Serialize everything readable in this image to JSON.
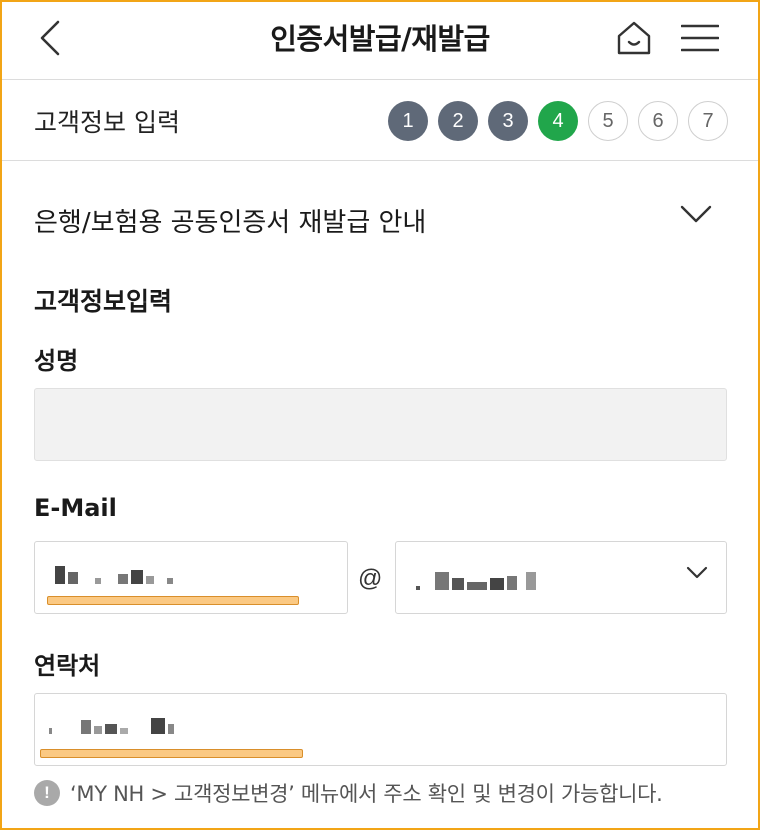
{
  "header": {
    "title": "인증서발급/재발급",
    "back_icon": "chevron-left-icon",
    "home_icon": "home-icon",
    "menu_icon": "hamburger-menu-icon"
  },
  "stepper": {
    "label": "고객정보 입력",
    "current_step": 4,
    "steps": [
      "1",
      "2",
      "3",
      "4",
      "5",
      "6",
      "7"
    ],
    "colors": {
      "done": "#5f6978",
      "current": "#21a64b",
      "todo": "#ffffff"
    }
  },
  "accordion": {
    "title": "은행/보험용 공동인증서 재발급 안내",
    "icon": "chevron-down-icon"
  },
  "form": {
    "section_title": "고객정보입력",
    "name": {
      "label": "성명",
      "value": ""
    },
    "email": {
      "label": "E-Mail",
      "local_value": "",
      "at": "@",
      "domain_value": "",
      "domain_icon": "chevron-down-icon"
    },
    "phone": {
      "label": "연락처",
      "value": ""
    }
  },
  "notice": {
    "icon": "info-icon",
    "icon_glyph": "!",
    "text": "‘MY NH > 고객정보변경’ 메뉴에서 주소 확인 및 변경이 가능합니다."
  },
  "highlight_color": "#fbc983"
}
